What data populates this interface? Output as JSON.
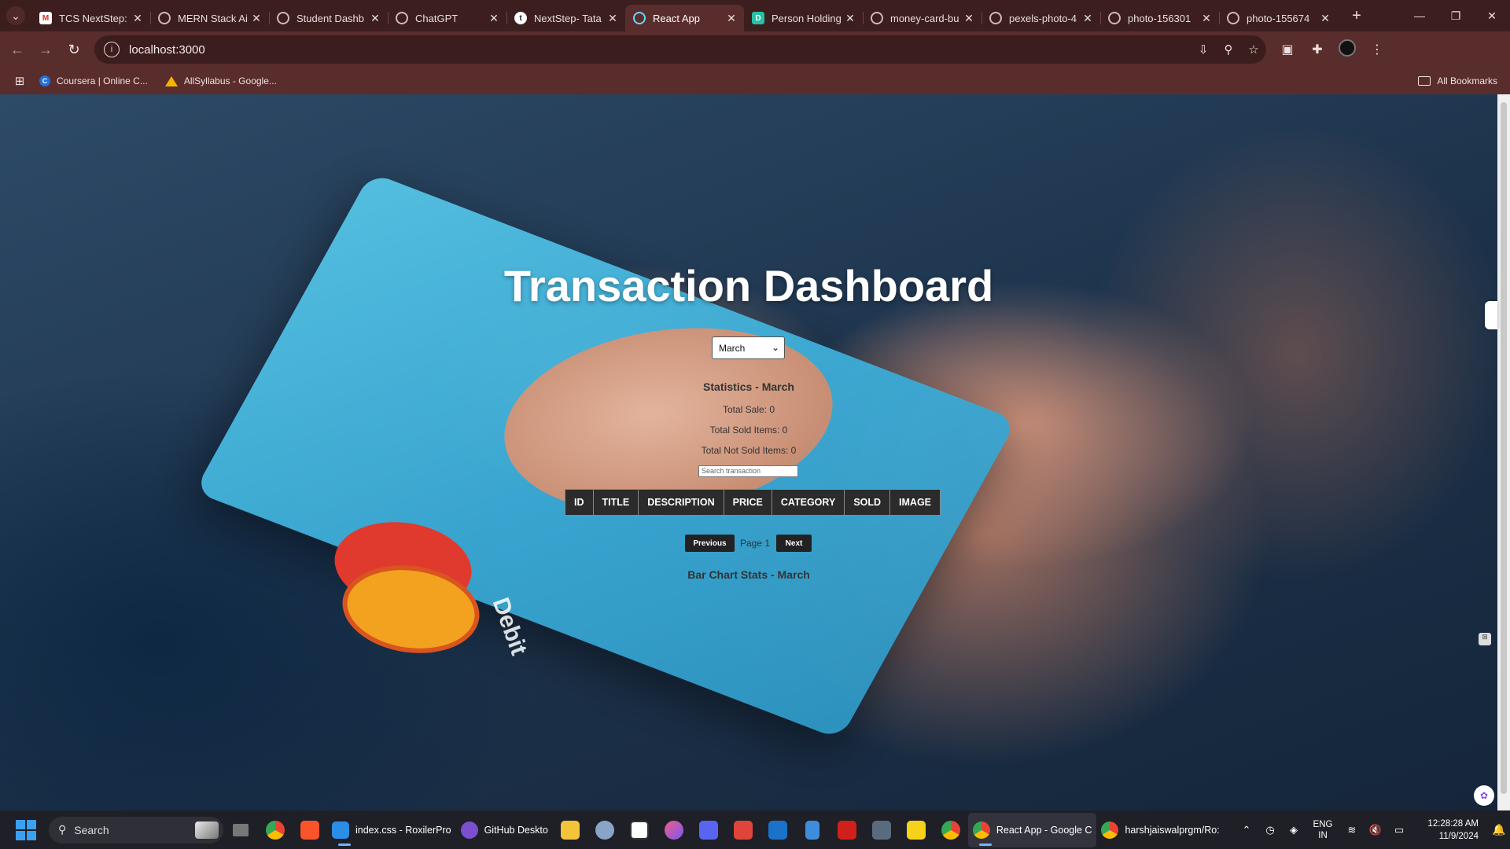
{
  "browser": {
    "tabs": [
      {
        "title": "TCS NextStep:",
        "icon": "gmail-icon"
      },
      {
        "title": "MERN Stack Ai",
        "icon": "chatgpt-icon"
      },
      {
        "title": "Student Dashb",
        "icon": "globe-icon"
      },
      {
        "title": "ChatGPT",
        "icon": "chatgpt-icon"
      },
      {
        "title": "NextStep- Tata",
        "icon": "tcs-icon"
      },
      {
        "title": "React App",
        "icon": "react-icon"
      },
      {
        "title": "Person Holding",
        "icon": "doc-icon"
      },
      {
        "title": "money-card-bu",
        "icon": "globe-icon"
      },
      {
        "title": "pexels-photo-4",
        "icon": "globe-icon"
      },
      {
        "title": "photo-156301",
        "icon": "globe-icon"
      },
      {
        "title": "photo-155674",
        "icon": "globe-icon"
      }
    ],
    "active_tab_index": 5,
    "url": "localhost:3000",
    "bookmarks": [
      {
        "label": "Coursera | Online C...",
        "icon": "coursera-icon"
      },
      {
        "label": "AllSyllabus - Google...",
        "icon": "google-drive-icon"
      }
    ],
    "all_bookmarks_label": "All Bookmarks"
  },
  "page": {
    "title": "Transaction Dashboard",
    "month_select": {
      "selected": "March"
    },
    "statistics": {
      "title": "Statistics - March",
      "total_sale": "Total Sale: 0",
      "total_sold": "Total Sold Items: 0",
      "total_not_sold": "Total Not Sold Items: 0"
    },
    "search_placeholder": "Search transaction",
    "table_headers": [
      "ID",
      "TITLE",
      "DESCRIPTION",
      "PRICE",
      "CATEGORY",
      "SOLD",
      "IMAGE"
    ],
    "pagination": {
      "previous_label": "Previous",
      "page_label": "Page 1",
      "next_label": "Next"
    },
    "bar_chart_title": "Bar Chart Stats - March",
    "background_card_text": "Debit"
  },
  "taskbar": {
    "search_label": "Search",
    "apps": [
      {
        "label": "index.css - RoxilerPro",
        "icon": "vscode-icon"
      },
      {
        "label": "GitHub Deskto",
        "icon": "github-icon"
      },
      {
        "label": "React App - Google C",
        "icon": "chrome-icon"
      },
      {
        "label": "harshjaiswalprgm/Ro:",
        "icon": "chrome-icon"
      }
    ],
    "lang_line1": "ENG",
    "lang_line2": "IN",
    "time": "12:28:28 AM",
    "date": "11/9/2024"
  },
  "colors": {
    "chrome_dark": "#3c1e1e",
    "chrome_toolbar": "#5a2d2d",
    "table_header_bg": "#2b2b2b",
    "button_bg": "#222222",
    "card_blue": "#3aaad6"
  }
}
